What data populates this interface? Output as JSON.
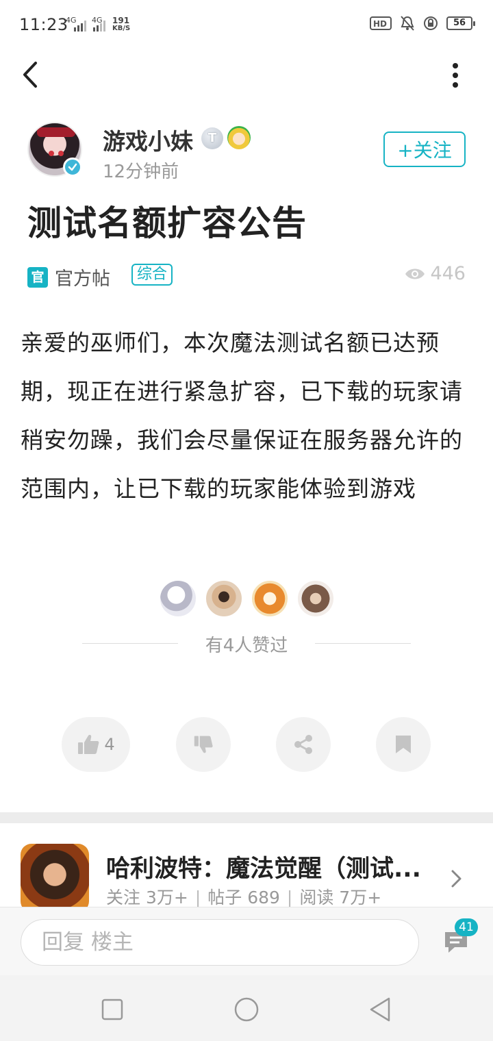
{
  "status_bar": {
    "time": "11:23",
    "net1": "4G",
    "net2": "4G",
    "speed_value": "191",
    "speed_unit": "KB/S",
    "battery": "56"
  },
  "author": {
    "name": "游戏小妹",
    "badge_letter": "T",
    "posted": "12分钟前",
    "follow_label": "+关注"
  },
  "post": {
    "title": "测试名额扩容公告",
    "official_box": "官",
    "official_label": "官方帖",
    "category": "综合",
    "views": "446",
    "content": "亲爱的巫师们，本次魔法测试名额已达预期，现正在进行紧急扩容，已下载的玩家请稍安勿躁，我们会尽量保证在服务器允许的范围内，让已下载的玩家能体验到游戏"
  },
  "likers": {
    "summary": "有4人赞过"
  },
  "actions": {
    "like_count": "4"
  },
  "game": {
    "title": "哈利波特：魔法觉醒（测试...",
    "follow_stat": "关注 3万+",
    "posts_stat": "帖子 689",
    "reads_stat": "阅读 7万+",
    "separator": "|"
  },
  "reply_bar": {
    "placeholder": "回复  楼主",
    "comment_count": "41"
  },
  "colors": {
    "accent": "#16b3c4"
  }
}
